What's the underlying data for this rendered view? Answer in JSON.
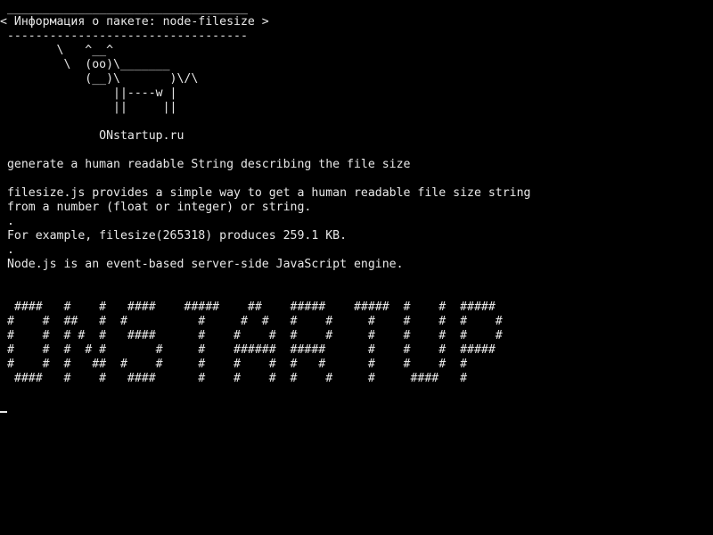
{
  "terminal": {
    "lines": [
      " __________________________________",
      "< Информация о пакете: node-filesize >",
      " ----------------------------------",
      "        \\   ^__^",
      "         \\  (oo)\\_______",
      "            (__)\\       )\\/\\",
      "                ||----w |",
      "                ||     ||",
      "",
      "              ONstartup.ru",
      "",
      " generate a human readable String describing the file size",
      "",
      " filesize.js provides a simple way to get a human readable file size string",
      " from a number (float or integer) or string.",
      " .",
      " For example, filesize(265318) produces 259.1 KB.",
      " .",
      " Node.js is an event-based server-side JavaScript engine.",
      "",
      "",
      "  ####   #    #   ####    #####    ##    #####    #####  #    #  #####",
      " #    #  ##   #  #          #     #  #   #    #     #    #    #  #    #",
      " #    #  # #  #   ####      #    #    #  #    #     #    #    #  #    #",
      " #    #  #  # #       #     #    ######  #####      #    #    #  #####",
      " #    #  #   ##  #    #     #    #    #  #   #      #    #    #  #",
      "  ####   #    #   ####      #    #    #  #    #     #     ####   #"
    ]
  }
}
